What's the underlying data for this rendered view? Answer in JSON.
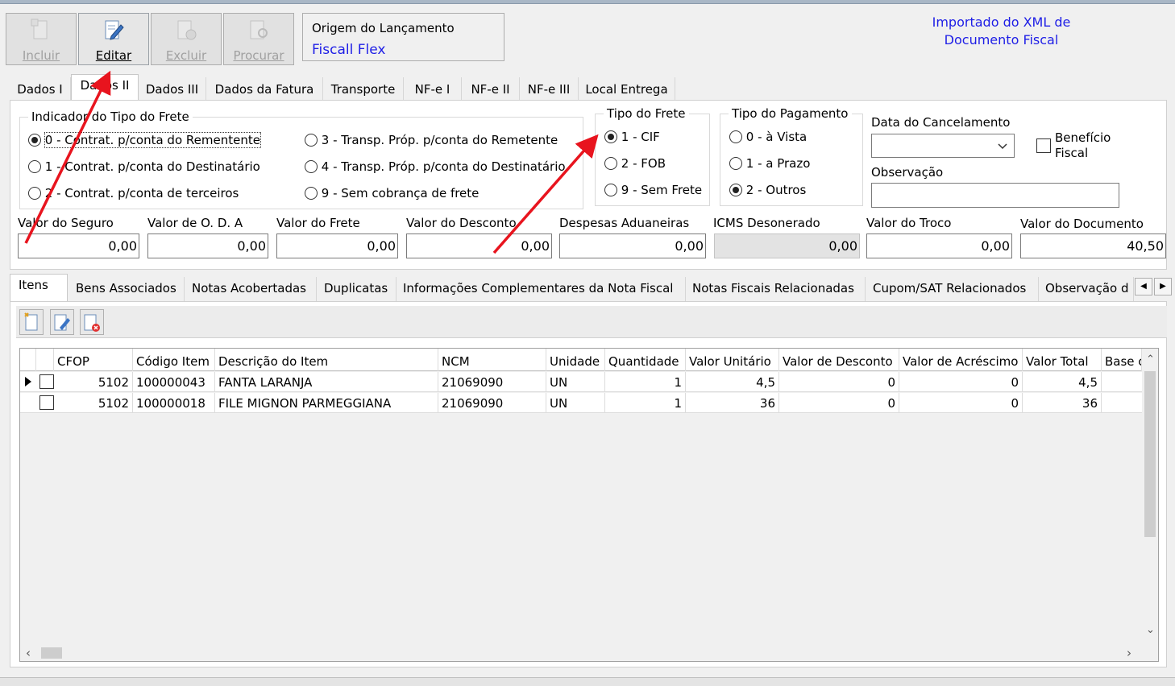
{
  "toolbar": {
    "incluir": "Incluir",
    "editar": "Editar",
    "excluir": "Excluir",
    "procurar": "Procurar"
  },
  "origem": {
    "label": "Origem do Lançamento",
    "value": "Fiscall Flex"
  },
  "importado": {
    "line1": "Importado do XML de",
    "line2": "Documento Fiscal"
  },
  "tabs": [
    "Dados I",
    "Dados II",
    "Dados III",
    "Dados da Fatura",
    "Transporte",
    "NF-e I",
    "NF-e II",
    "NF-e III",
    "Local Entrega"
  ],
  "frete_indicador": {
    "title": "Indicador do Tipo do Frete",
    "options": [
      "0 - Contrat. p/conta do Rementente",
      "1 - Contrat. p/conta do Destinatário",
      "2 - Contrat. p/conta de terceiros",
      "3 - Transp. Próp. p/conta do Remetente",
      "4 - Transp. Próp. p/conta do Destinatário",
      "9 - Sem cobrança de frete"
    ],
    "selected_index": 0
  },
  "tipo_frete": {
    "title": "Tipo do Frete",
    "options": [
      "1 - CIF",
      "2 - FOB",
      "9 - Sem Frete"
    ],
    "selected_index": 0
  },
  "tipo_pagamento": {
    "title": "Tipo do Pagamento",
    "options": [
      "0 - à Vista",
      "1 - a Prazo",
      "2 - Outros"
    ],
    "selected_index": 2
  },
  "cancelamento": {
    "label": "Data do Cancelamento",
    "value": ""
  },
  "beneficio": {
    "label1": "Benefício",
    "label2": "Fiscal",
    "checked": false
  },
  "observacao": {
    "label": "Observação",
    "value": ""
  },
  "valores": {
    "seguro": {
      "label": "Valor do Seguro",
      "value": "0,00"
    },
    "oda": {
      "label": "Valor de O. D. A",
      "value": "0,00"
    },
    "frete": {
      "label": "Valor do Frete",
      "value": "0,00"
    },
    "desconto": {
      "label": "Valor do Desconto",
      "value": "0,00"
    },
    "aduaneiras": {
      "label": "Despesas Aduaneiras",
      "value": "0,00"
    },
    "icms": {
      "label": "ICMS Desonerado",
      "value": "0,00"
    },
    "troco": {
      "label": "Valor do Troco",
      "value": "0,00"
    },
    "documento": {
      "label": "Valor do Documento",
      "value": "40,50"
    }
  },
  "subtabs": [
    "Itens",
    "Bens Associados",
    "Notas Acobertadas",
    "Duplicatas",
    "Informações Complementares da Nota Fiscal",
    "Notas Fiscais Relacionadas",
    "Cupom/SAT Relacionados",
    "Observação d"
  ],
  "grid": {
    "columns": [
      "CFOP",
      "Código Item",
      "Descrição do Item",
      "NCM",
      "Unidade",
      "Quantidade",
      "Valor Unitário",
      "Valor de Desconto",
      "Valor de Acréscimo",
      "Valor Total",
      "Base c"
    ],
    "rows": [
      [
        "5102",
        "100000043",
        "FANTA LARANJA",
        "21069090",
        "UN",
        "1",
        "4,5",
        "0",
        "0",
        "4,5"
      ],
      [
        "5102",
        "100000018",
        "FILE MIGNON PARMEGGIANA",
        "21069090",
        "UN",
        "1",
        "36",
        "0",
        "0",
        "36"
      ]
    ]
  },
  "colors": {
    "link_blue": "#1e1ee6",
    "annotation_red": "#e8141e"
  }
}
